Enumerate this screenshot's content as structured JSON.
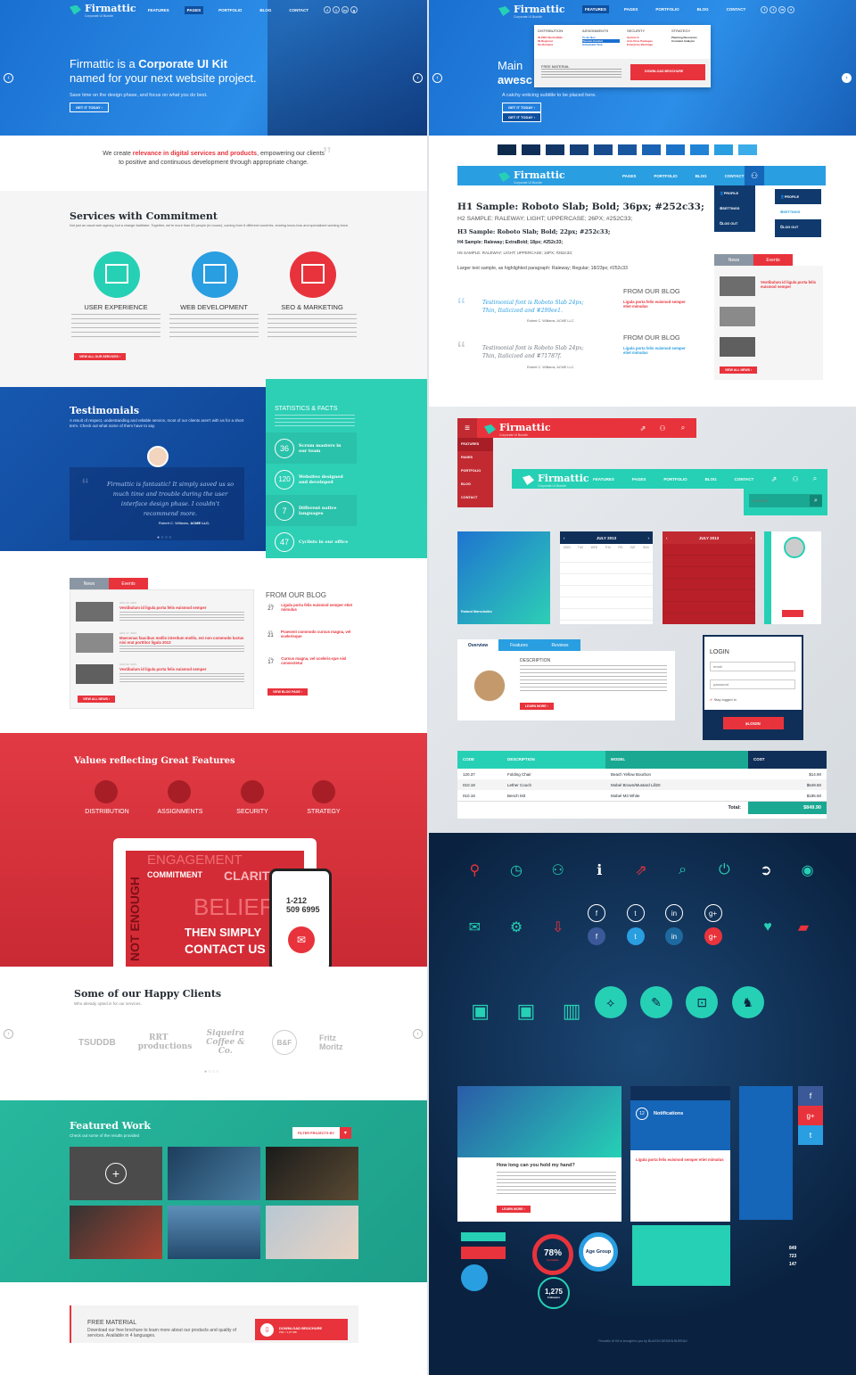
{
  "brand": {
    "name": "Firmattic",
    "tagline": "Corporate UI Bundle"
  },
  "nav": {
    "features": "FEATURES",
    "pages": "PAGES",
    "portfolio": "PORTFOLIO",
    "blog": "BLOG",
    "contact": "CONTACT"
  },
  "hero": {
    "title_pre": "Firmattic is a ",
    "title_bold": "Corporate UI Kit",
    "title_line2": "named for your next website project.",
    "subtitle": "Save time on the design phase, and focus on what you do best.",
    "cta": "GET IT TODAY"
  },
  "intro": {
    "pre": "We create ",
    "bold": "relevance in digital services and products",
    "post": ", empowering our clients",
    "line2": "to positive and continuous development through appropriate change."
  },
  "services": {
    "title": "Services with Commitment",
    "desc": "Not just an usual web agency, but a change facilitator. Together, we're more than 83 people (in-house), coming from 8 different countries, sharing know-how and specialized working force.",
    "items": [
      {
        "label": "USER EXPERIENCE"
      },
      {
        "label": "WEB DEVELOPMENT"
      },
      {
        "label": "SEO & MARKETING"
      }
    ],
    "button": "VIEW ALL OUR SERVICES"
  },
  "testimonials": {
    "title": "Testimonials",
    "desc": "A result of respect, understanding and reliable service, most of our clients aren't with us for a short term. Check out what some of them have to say.",
    "quote": "Firmattic is fantastic! It simply saved us so much time and trouble during the user interface design phase. I couldn't recommend more.",
    "author": "Robert C. Williams, ",
    "company": "ACME LLC."
  },
  "stats": {
    "title": "STATISTICS & FACTS",
    "items": [
      {
        "n": "36",
        "label": "Scrum masters in our team"
      },
      {
        "n": "120",
        "label": "Websites designed and developed"
      },
      {
        "n": "7",
        "label": "Different native languages"
      },
      {
        "n": "47",
        "label": "Cyclists in our office"
      }
    ]
  },
  "news": {
    "tab_news": "News",
    "tab_events": "Events",
    "items": [
      {
        "date": "AUG 23, 2013",
        "title": "Vestibulum id ligula porta felis euismod semper"
      },
      {
        "date": "AUG 17, 2013",
        "title": "Maecenas faucibus mollis interdum mollis, est non commodo luctus nisi erat porttitor ligula 2013"
      },
      {
        "date": "AUG 03, 2013",
        "title": "Vestibulum id ligula porta felis euismod semper"
      }
    ],
    "button": "VIEW ALL NEWS"
  },
  "blog": {
    "title": "FROM OUR BLOG",
    "items": [
      {
        "month": "JUL",
        "day": "27",
        "title": "Ligula porta felis euismod semper etiet mimulus"
      },
      {
        "month": "JUL",
        "day": "21",
        "title": "Praesent commodo cursus magna, vel scelerisque"
      },
      {
        "month": "JUL",
        "day": "17",
        "title": "Cursus magna, vel sceleris-que nisl consectetur"
      }
    ],
    "button": "VIEW BLOG PAGE"
  },
  "values": {
    "title": "Values reflecting Great Features",
    "items": [
      {
        "label": "DISTRIBUTION"
      },
      {
        "label": "ASSIGNMENTS"
      },
      {
        "label": "SECURITY"
      },
      {
        "label": "STRATEGY"
      }
    ]
  },
  "poster": {
    "l1": "NOT ENOUGH",
    "l2": "ENGAGEMENT",
    "l3": "COMMITMENT",
    "l4": "CLARITY",
    "l5": "BELIEF",
    "l6": "THEN SIMPLY",
    "l7": "CONTACT US",
    "phone1": "1-212",
    "phone2": "509 6995"
  },
  "clients": {
    "title": "Some of our Happy Clients",
    "desc": "Who already opted in for our services.",
    "logos": [
      "TSUDDB",
      "RRT productions",
      "Siqueira Coffee & Co.",
      "B&F",
      "Fritz Moritz"
    ]
  },
  "featured": {
    "title": "Featured Work",
    "desc": "Check out some of the results provided",
    "filter": "FILTER PROJECTS BY"
  },
  "footer_cta": {
    "title": "FREE MATERIAL",
    "desc": "Download our free brochure to learn more about our products and quality of services. Available in 4 languages.",
    "button": "DOWNLOAD BROCHURE",
    "sub": "PDF / 1,07 MB"
  },
  "mega": {
    "cols": [
      {
        "h": "DISTRIBUTION",
        "items": [
          "IN-PRO World-Wide",
          "IN-Regional",
          "On-Demand"
        ]
      },
      {
        "h": "ASSIGNMENTS",
        "items": [
          "To-do Box",
          "Tension Control",
          "Scheduled Task"
        ]
      },
      {
        "h": "SECURITY",
        "items": [
          "System S",
          "Anti-Virus Packages",
          "Enterprise Blockage"
        ]
      },
      {
        "h": "STRATEGY",
        "items": [
          "Planning Resources",
          "Constant Analysis"
        ]
      }
    ],
    "free_title": "FREE MATERIAL",
    "download": "DOWNLOAD BROCHURE"
  },
  "hero2": {
    "title_a": "Main",
    "title_b": "awesc",
    "subtitle": "A catchy enticing subtitle to be placed here.",
    "cta": "GET IT TODAY"
  },
  "typo": {
    "h1": "H1 Sample: Roboto Slab; Bold; 36px; #252c33;",
    "h2": "H2 SAMPLE: RALEWAY; LIGHT; UPPERCASE; 26PX; #252C33;",
    "h3": "H3 Sample: Roboto Slab; Bold; 22px; #252c33;",
    "h4": "H4 Sample: Raleway; ExtraBold; 18px; #252c33;",
    "h5": "H5 SAMPLE: RALEWAY; LIGHT; UPPERCASE; 16PX; #252c33;",
    "p": "Larger text sample, as highlighted paragraph: Raleway; Regular; 18/23px; #252c33",
    "t1": "Testimonial font is Roboto Slab 24px; Thin, Italicized and #299ee1.",
    "t2": "Testimonial font is Roboto Slab 24px; Thin, Italicized and #71787f.",
    "author": "Robert C. Williams, ACME LLC."
  },
  "menu": {
    "profile": "PROFILE",
    "settings": "SETTINGS",
    "logout": "LOG OUT"
  },
  "search": {
    "placeholder": "Keyword"
  },
  "calendar": {
    "month": "JULY 2013",
    "days": [
      "MON",
      "TUE",
      "WED",
      "THU",
      "FRI",
      "SAT",
      "SUN"
    ]
  },
  "login": {
    "title": "LOGIN",
    "email": "email",
    "password": "password",
    "remember": "Stay logged in",
    "button": "LOGIN"
  },
  "tabs": {
    "overview": "Overview",
    "features": "Features",
    "reviews": "Reviews",
    "desc_title": "DESCRIPTION",
    "more": "LEARN MORE"
  },
  "table": {
    "headers": [
      "CODE",
      "DESCRIPTION",
      "MODEL",
      "COST"
    ],
    "rows": [
      [
        "120.37",
        "Folding Chair",
        "Beach Yellow Bourbon",
        "$14.90"
      ],
      [
        "010.18",
        "Lether Couch",
        "Mobel Brown/Mustard Lill20",
        "$649.50"
      ],
      [
        "010.18",
        "Bench M3",
        "Mobel M3 White",
        "$185.50"
      ]
    ],
    "total_label": "Total:",
    "total": "$849.90"
  },
  "widgets": {
    "notif_count": "12",
    "notif_title": "Notifications",
    "article_title": "How long can you hold my hand?",
    "pct": "78%",
    "pct_label": "Complete",
    "age": "Age Group",
    "followers": "1,275",
    "followers_label": "Followers",
    "social": [
      "849",
      "723",
      "147"
    ],
    "credit": "Firmattic UI Kit is brought to you by BLAZON DESIGN BUREAU"
  },
  "colors": {
    "blue": "#299ee1",
    "red": "#e8333c",
    "teal": "#26d0b5",
    "navy": "#0e2a4a"
  }
}
